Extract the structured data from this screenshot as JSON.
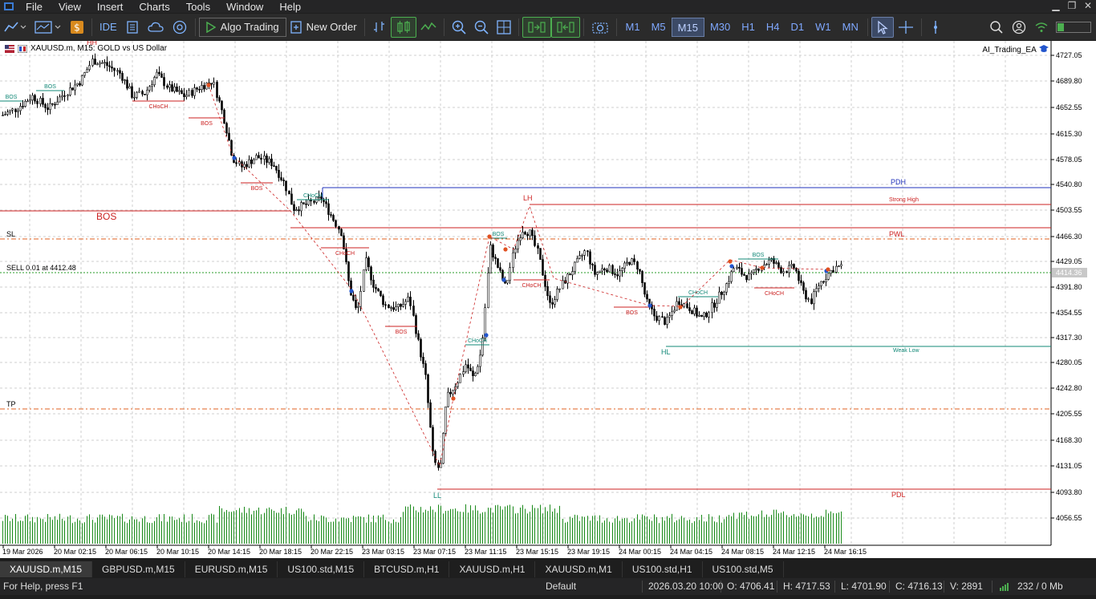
{
  "menubar": {
    "items": [
      "File",
      "View",
      "Insert",
      "Charts",
      "Tools",
      "Window",
      "Help"
    ]
  },
  "toolbar": {
    "ide_label": "IDE",
    "algo_trading_label": "Algo Trading",
    "new_order_label": "New Order",
    "timeframes": [
      "M1",
      "M5",
      "M15",
      "M30",
      "H1",
      "H4",
      "D1",
      "W1",
      "MN"
    ],
    "active_timeframe": "M15"
  },
  "chart": {
    "title": "XAUUSD.m, M15:  GOLD vs US Dollar",
    "ea_name": "AI_Trading_EA",
    "current_price_label": "4414.36",
    "price_ticks": [
      "4727.05",
      "4689.80",
      "4652.55",
      "4615.30",
      "4578.05",
      "4540.80",
      "4503.55",
      "4466.30",
      "4429.05",
      "4391.80",
      "4354.55",
      "4317.30",
      "4280.05",
      "4242.80",
      "4205.55",
      "4168.30",
      "4131.05",
      "4093.80",
      "4056.55"
    ],
    "time_ticks": [
      "19 Mar 2026",
      "20 Mar 02:15",
      "20 Mar 06:15",
      "20 Mar 10:15",
      "20 Mar 14:15",
      "20 Mar 18:15",
      "20 Mar 22:15",
      "23 Mar 03:15",
      "23 Mar 07:15",
      "23 Mar 11:15",
      "23 Mar 15:15",
      "23 Mar 19:15",
      "24 Mar 00:15",
      "24 Mar 04:15",
      "24 Mar 08:15",
      "24 Mar 12:15",
      "24 Mar 16:15"
    ],
    "levels": {
      "pdh": "PDH",
      "strong_high": "Strong High",
      "pwl": "PWL",
      "weak_low": "Weak Low",
      "pdl": "PDL",
      "bos_big": "BOS",
      "sl": "SL",
      "tp": "TP",
      "sell_order": "SELL 0.01 at 4412.48"
    },
    "annotations": {
      "hh": "HH",
      "lh": "LH",
      "hl": "HL",
      "ll": "LL",
      "bos": "BOS",
      "choch": "CHoCH"
    },
    "colors": {
      "bullish_candle": "#000000",
      "bearish_candle": "#000000",
      "volume": "#1a8a1a",
      "level_red": "#cc2222",
      "level_blue": "#2233bb",
      "level_teal": "#118877",
      "order_line": "#2a9d2a"
    }
  },
  "tabs": {
    "items": [
      "XAUUSD.m,M15",
      "GBPUSD.m,M15",
      "EURUSD.m,M15",
      "US100.std,M15",
      "BTCUSD.m,H1",
      "XAUUSD.m,H1",
      "XAUUSD.m,M1",
      "US100.std,H1",
      "US100.std,M5"
    ],
    "active": 0
  },
  "status": {
    "help": "For Help, press F1",
    "profile": "Default",
    "datetime": "2026.03.20 10:00",
    "open": "O: 4706.41",
    "high": "H: 4717.53",
    "low": "L: 4701.90",
    "close": "C: 4716.13",
    "volume": "V: 2891",
    "traffic": "232 / 0 Mb"
  }
}
